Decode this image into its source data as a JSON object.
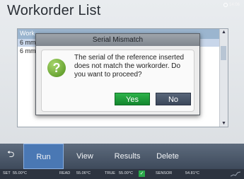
{
  "window": {
    "title": "Workorder List",
    "clock": "14:06"
  },
  "list": {
    "header": "Work",
    "rows": [
      "6 mm",
      "6 mm"
    ]
  },
  "dialog": {
    "title": "Serial Mismatch",
    "message": "The serial of the reference inserted does not match the workorder. Do you want to proceed?",
    "yes_label": "Yes",
    "no_label": "No",
    "icon": "question-icon"
  },
  "toolbar": {
    "back_icon": "back-arrow-icon",
    "tabs": [
      "Run",
      "View",
      "Results",
      "Delete"
    ],
    "active_tab": "Run"
  },
  "status": {
    "set_label": "SET",
    "set_value": "55.00°C",
    "read_label": "READ",
    "read_value": "55.06°C",
    "true_label": "TRUE",
    "true_value": "55.00°C",
    "sensor_label": "SENSOR",
    "sensor_value": "54.81°C"
  },
  "colors": {
    "yes": "#1f9e3a",
    "no": "#4a5668",
    "active_tab": "#4a78b4",
    "toolbar": "#4b5869"
  }
}
